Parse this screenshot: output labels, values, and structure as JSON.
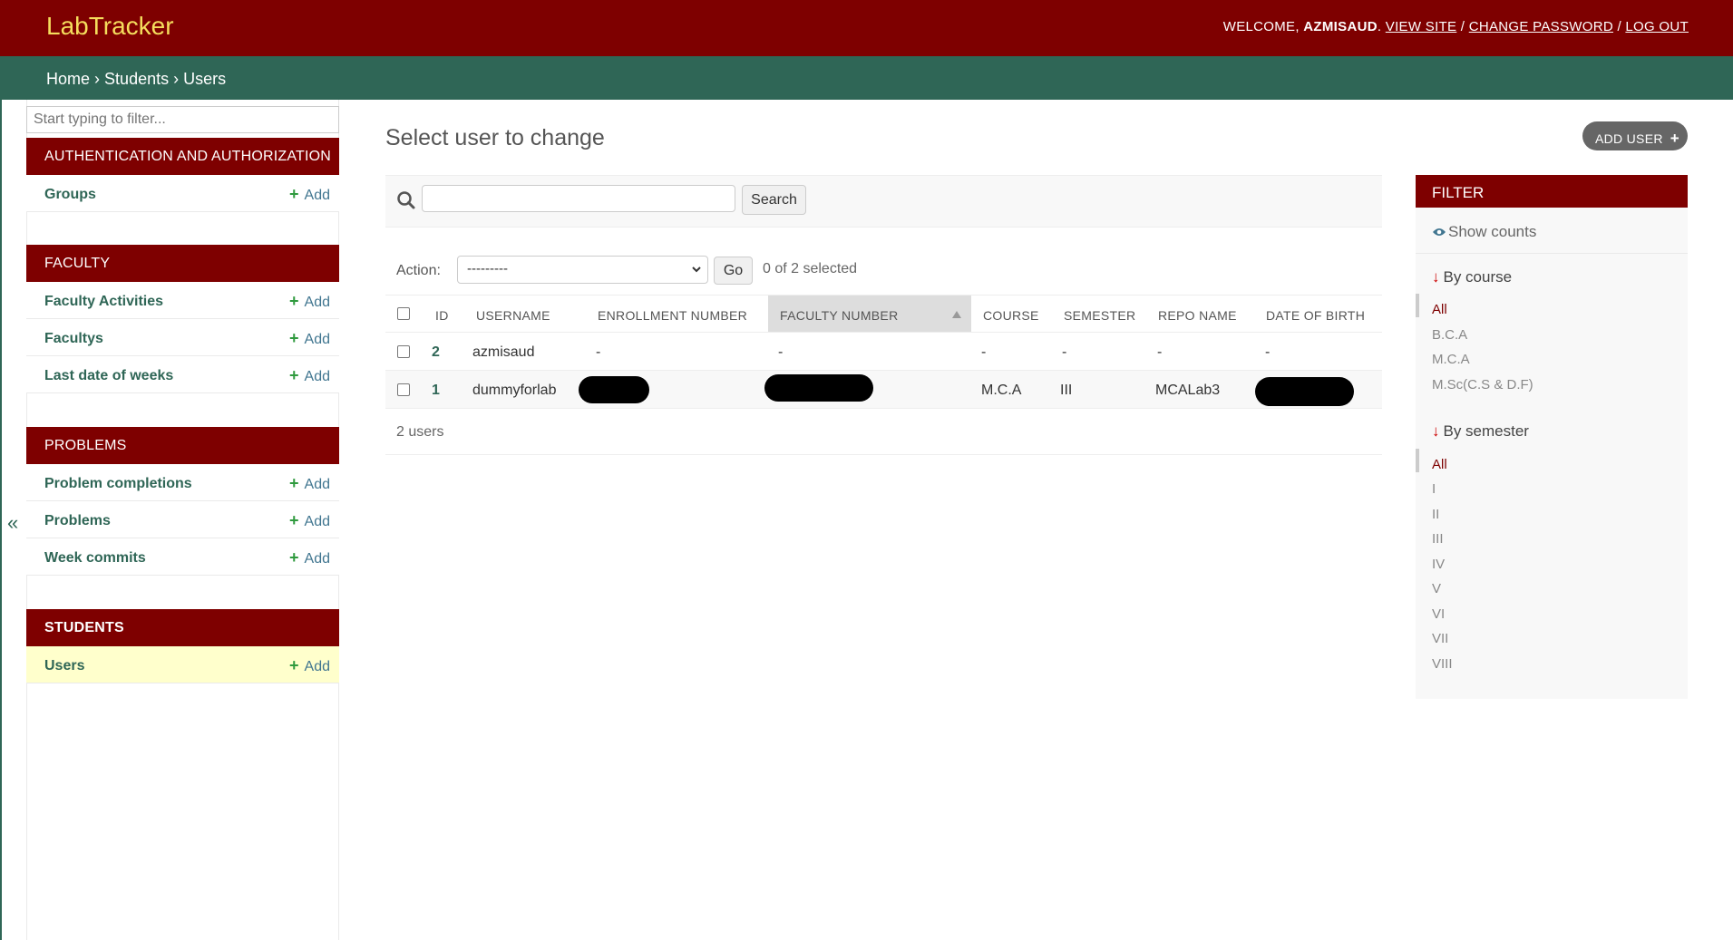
{
  "header": {
    "brand": "LabTracker",
    "welcome": "WELCOME,",
    "username": "AZMISAUD",
    "view_site": "VIEW SITE",
    "change_password": "CHANGE PASSWORD",
    "log_out": "LOG OUT",
    "sep": "/"
  },
  "breadcrumbs": [
    "Home",
    "Students",
    "Users"
  ],
  "breadcrumb_sep": "›",
  "sidebar": {
    "filter_placeholder": "Start typing to filter...",
    "add_label": "Add",
    "modules": [
      {
        "caption": "AUTHENTICATION AND AUTHORIZATION",
        "models": [
          "Groups"
        ]
      },
      {
        "caption": "FACULTY",
        "models": [
          "Faculty Activities",
          "Facultys",
          "Last date of weeks"
        ]
      },
      {
        "caption": "PROBLEMS",
        "models": [
          "Problem completions",
          "Problems",
          "Week commits"
        ]
      },
      {
        "caption": "STUDENTS",
        "models": [
          "Users"
        ]
      }
    ],
    "collapse_icon": "«"
  },
  "content": {
    "title": "Select user to change",
    "add_user": "ADD USER",
    "search_button": "Search",
    "action_label": "Action:",
    "action_value": "---------",
    "go": "Go",
    "selected": "0 of 2 selected",
    "columns": [
      "ID",
      "USERNAME",
      "ENROLLMENT NUMBER",
      "FACULTY NUMBER",
      "COURSE",
      "SEMESTER",
      "REPO NAME",
      "DATE OF BIRTH"
    ],
    "rows": [
      {
        "id": "2",
        "username": "azmisaud",
        "enrollment": "-",
        "faculty": "-",
        "course": "-",
        "semester": "-",
        "repo": "-",
        "dob": "-"
      },
      {
        "id": "1",
        "username": "dummyforlab",
        "enrollment": "",
        "faculty": "",
        "course": "M.C.A",
        "semester": "III",
        "repo": "MCALab3",
        "dob": ""
      }
    ],
    "result_count": "2 users"
  },
  "filter": {
    "title": "FILTER",
    "show_counts": "Show counts",
    "by_course": "By course",
    "courses": [
      "All",
      "B.C.A",
      "M.C.A",
      "M.Sc(C.S & D.F)"
    ],
    "by_semester": "By semester",
    "semesters": [
      "All",
      "I",
      "II",
      "III",
      "IV",
      "V",
      "VI",
      "VII",
      "VIII"
    ]
  },
  "colors": {
    "header_bg": "#7e0000",
    "breadcrumb_bg": "#2f6656",
    "brand": "#f5dd5d",
    "link": "#2f6656",
    "current_row": "#ffffcc"
  }
}
